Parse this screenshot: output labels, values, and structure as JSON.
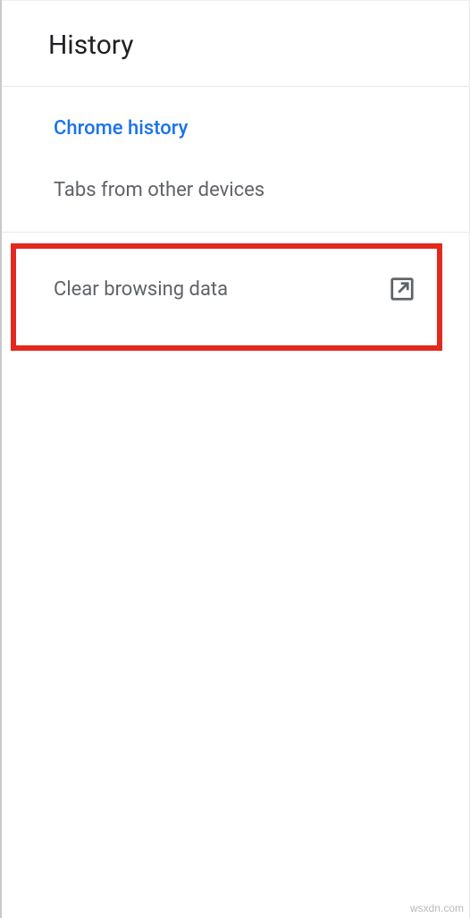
{
  "header": {
    "title": "History"
  },
  "menu": {
    "items": [
      {
        "label": "Chrome history",
        "active": true
      },
      {
        "label": "Tabs from other devices",
        "active": false
      }
    ]
  },
  "clear": {
    "label": "Clear browsing data",
    "icon": "launch-icon"
  },
  "watermark": "wsxdn.com"
}
